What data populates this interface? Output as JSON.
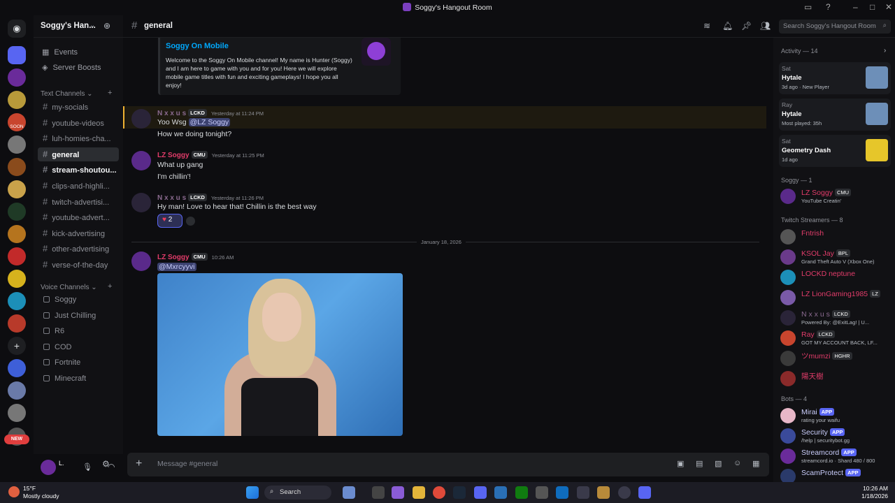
{
  "window": {
    "title": "Soggy's Hangout Room"
  },
  "guild": {
    "name": "Soggy's Han..."
  },
  "nav": {
    "events": "Events",
    "boosts": "Server Boosts"
  },
  "categories": {
    "text": "Text Channels",
    "voice": "Voice Channels"
  },
  "text_channels": [
    "my-socials",
    "youtube-videos",
    "luh-homies-cha...",
    "general",
    "stream-shoutou...",
    "clips-and-highli...",
    "twitch-advertisi...",
    "youtube-advert...",
    "kick-advertising",
    "other-advertising",
    "verse-of-the-day"
  ],
  "voice_channels": [
    "Soggy",
    "Just Chilling",
    "R6",
    "COD",
    "Fortnite",
    "Minecraft"
  ],
  "server_badges": {
    "soon": "SOON",
    "new": "NEW"
  },
  "header": {
    "channel": "general",
    "search_placeholder": "Search Soggy's Hangout Room"
  },
  "embed": {
    "title": "Soggy On Mobile",
    "description": "Welcome to the Soggy On Mobile channel! My name is Hunter (Soggy) and I am here to game with you and for you! Here we will explore mobile game titles with fun and exciting gameplays! I hope you all enjoy!"
  },
  "messages": [
    {
      "author": "N x x u s",
      "tag": "LCKD",
      "time": "Yesterday at 11:24 PM",
      "lines": [
        "Yoo Wsg ",
        "How we doing tonight?"
      ],
      "mention": "@LZ Soggy",
      "color": "#8a6a8f"
    },
    {
      "author": "LZ Soggy",
      "tag": "CMU",
      "time": "Yesterday at 11:25 PM",
      "lines": [
        "What up gang",
        "I'm chillin'!"
      ],
      "color": "#e23c6a"
    },
    {
      "author": "N x x u s",
      "tag": "LCKD",
      "time": "Yesterday at 11:26 PM",
      "lines": [
        "Hy man! Love to hear that! Chillin is the best way"
      ],
      "color": "#8a6a8f",
      "reaction_count": "2"
    },
    {
      "author": "LZ Soggy",
      "tag": "CMU",
      "time": "10:26 AM",
      "mention": "@Mxrcyyvi",
      "color": "#e23c6a"
    }
  ],
  "date_divider": "January 18, 2026",
  "composer": {
    "placeholder": "Message #general"
  },
  "members": {
    "activity_header": "Activity — 14",
    "activity": [
      {
        "who": "Sat",
        "game": "Hytale",
        "sub": "3d ago · New Player"
      },
      {
        "who": "Ray",
        "game": "Hytale",
        "sub": "Most played: 35h"
      },
      {
        "who": "Sat",
        "game": "Geometry Dash",
        "sub": "1d ago"
      }
    ],
    "soggy_header": "Soggy — 1",
    "soggy": [
      {
        "name": "LZ Soggy",
        "tag": "CMU",
        "status": "YouTube Creatin'",
        "color": "#e23c6a"
      }
    ],
    "twitch_header": "Twitch Streamers — 8",
    "twitch": [
      {
        "name": "Fntrish",
        "tag": "",
        "status": "",
        "color": "#e23c6a"
      },
      {
        "name": "KSOL Jay",
        "tag": "BPL",
        "status": "Grand Theft Auto V (Xbox One)",
        "color": "#e23c6a"
      },
      {
        "name": "LOCKD neptune",
        "tag": "",
        "status": "",
        "color": "#e23c6a"
      },
      {
        "name": "LZ LionGaming1985",
        "tag": "LZ",
        "status": "",
        "color": "#e23c6a"
      },
      {
        "name": "N x x u s",
        "tag": "LCKD",
        "status": "Powered By: @ExitLag! | U...",
        "color": "#8a6a8f"
      },
      {
        "name": "Ray",
        "tag": "LCKD",
        "status": "GOT MY ACCOUNT BACK, LF...",
        "color": "#e23c6a"
      },
      {
        "name": "ツmumzi",
        "tag": "HGHR",
        "status": "",
        "color": "#e23c6a"
      },
      {
        "name": "陽天樹",
        "tag": "",
        "status": "",
        "color": "#e23c6a"
      }
    ],
    "bots_header": "Bots — 4",
    "bots": [
      {
        "name": "Mirai",
        "tag": "APP",
        "status": "rating your waifu"
      },
      {
        "name": "Security",
        "tag": "APP",
        "status": "/help | securitybot.gg"
      },
      {
        "name": "Streamcord",
        "tag": "APP",
        "status": "streamcord.io · Shard 480 / 800"
      },
      {
        "name": "ScamProtect",
        "tag": "APP",
        "status": ""
      }
    ]
  },
  "taskbar": {
    "temp": "15°F",
    "weather": "Mostly cloudy",
    "search": "Search",
    "time": "10:26 AM",
    "date": "1/18/2026"
  },
  "colors": {
    "accent": "#5865f2",
    "link": "#00a8fc",
    "brand_red": "#e23c6a"
  }
}
